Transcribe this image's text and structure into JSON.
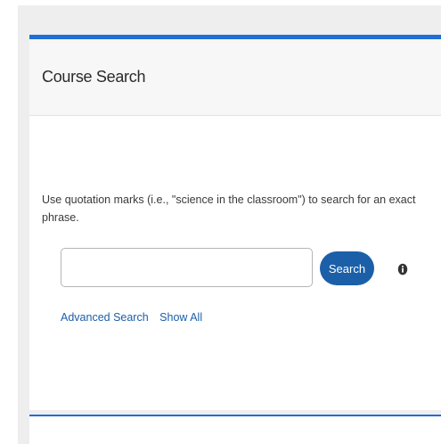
{
  "card": {
    "title": "Course Search",
    "hint": "Use quotation marks (i.e., \"science in the classroom\") to search for an exact phrase."
  },
  "search": {
    "value": "",
    "placeholder": "",
    "button_label": "Search"
  },
  "links": {
    "advanced_search": "Advanced Search",
    "show_all": "Show All"
  },
  "icons": {
    "info": "info-icon"
  },
  "colors": {
    "accent": "#1f6fd6",
    "button": "#1b5fa8",
    "link": "#1b5fa8",
    "page_background": "#eeeeee"
  }
}
